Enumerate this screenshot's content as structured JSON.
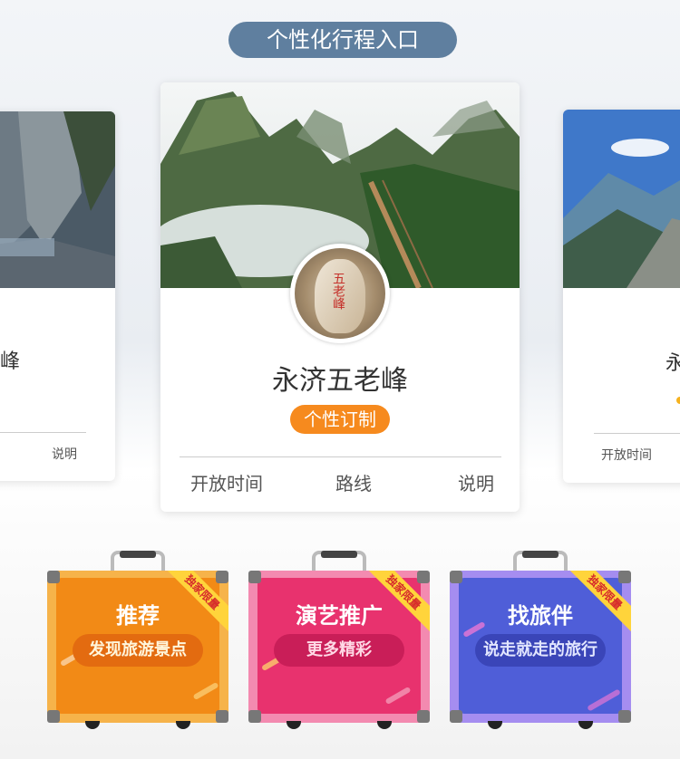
{
  "banner": {
    "title": "个性化行程入口"
  },
  "main_card": {
    "title": "永济五老峰",
    "badge": "个性订制",
    "avatar_inscription": "五老峰",
    "footer": [
      "开放时间",
      "路线",
      "说明"
    ]
  },
  "left_card": {
    "title_fragment": "峰",
    "footer_right": "说明"
  },
  "right_card": {
    "title_fragment": "永",
    "footer_left": "开放时间"
  },
  "cases": [
    {
      "title": "推荐",
      "pill": "发现旅游景点",
      "ribbon": "独家限量",
      "color": "#f28a16",
      "frame": "#f6b34a",
      "pill_bg": "#e36b10",
      "pill_fg": "#fff6dc"
    },
    {
      "title": "演艺推广",
      "pill": "更多精彩",
      "ribbon": "独家限量",
      "color": "#e8326e",
      "frame": "#f38ab0",
      "pill_bg": "#c91e58",
      "pill_fg": "#ffd9e6"
    },
    {
      "title": "找旅伴",
      "pill": "说走就走的旅行",
      "ribbon": "独家限量",
      "color": "#4f5ed8",
      "frame": "#a58df0",
      "pill_bg": "#3a45b8",
      "pill_fg": "#e2e6ff"
    }
  ]
}
